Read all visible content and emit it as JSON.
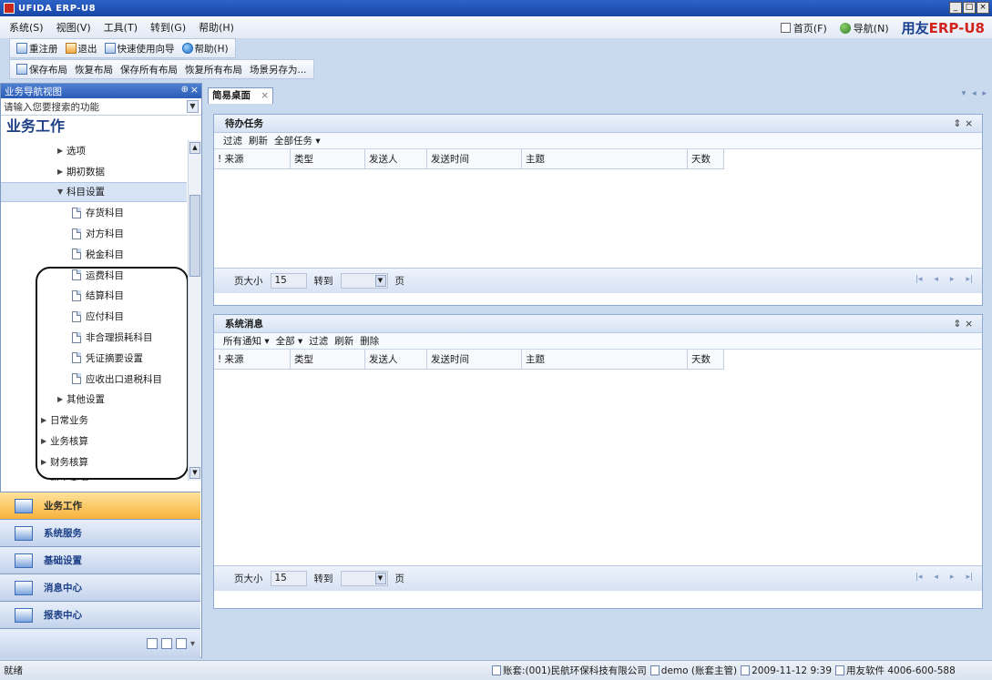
{
  "window": {
    "title": "UFIDA ERP-U8"
  },
  "menu": {
    "items": [
      "系统(S)",
      "视图(V)",
      "工具(T)",
      "转到(G)",
      "帮助(H)"
    ],
    "home": "首页(F)",
    "nav": "导航(N)",
    "brand_a": "用友",
    "brand_b": "ERP-U8"
  },
  "toolbar1": {
    "relogin": "重注册",
    "exit": "退出",
    "wizard": "快速使用向导",
    "help": "帮助(H)"
  },
  "toolbar2": {
    "save_layout": "保存布局",
    "restore_layout": "恢复布局",
    "save_all": "保存所有布局",
    "restore_all": "恢复所有布局",
    "scene_save": "场景另存为..."
  },
  "left": {
    "header": "业务导航视图",
    "search_placeholder": "请输入您要搜索的功能",
    "section": "业务工作",
    "tree": [
      {
        "label": "选项",
        "level": 2,
        "kind": "arrow"
      },
      {
        "label": "期初数据",
        "level": 2,
        "kind": "arrow"
      },
      {
        "label": "科目设置",
        "level": 2,
        "kind": "open"
      },
      {
        "label": "存货科目",
        "level": 3,
        "kind": "doc"
      },
      {
        "label": "对方科目",
        "level": 3,
        "kind": "doc"
      },
      {
        "label": "税金科目",
        "level": 3,
        "kind": "doc"
      },
      {
        "label": "运费科目",
        "level": 3,
        "kind": "doc"
      },
      {
        "label": "结算科目",
        "level": 3,
        "kind": "doc"
      },
      {
        "label": "应付科目",
        "level": 3,
        "kind": "doc"
      },
      {
        "label": "非合理损耗科目",
        "level": 3,
        "kind": "doc"
      },
      {
        "label": "凭证摘要设置",
        "level": 3,
        "kind": "doc"
      },
      {
        "label": "应收出口退税科目",
        "level": 3,
        "kind": "doc"
      },
      {
        "label": "其他设置",
        "level": 2,
        "kind": "arrow"
      },
      {
        "label": "日常业务",
        "level": 1,
        "kind": "arrow"
      },
      {
        "label": "业务核算",
        "level": 1,
        "kind": "arrow"
      },
      {
        "label": "财务核算",
        "level": 1,
        "kind": "arrow"
      },
      {
        "label": "账表查询",
        "level": 1,
        "kind": "arrow"
      }
    ],
    "panes": [
      {
        "label": "业务工作",
        "active": true
      },
      {
        "label": "系统服务",
        "active": false
      },
      {
        "label": "基础设置",
        "active": false
      },
      {
        "label": "消息中心",
        "active": false
      },
      {
        "label": "报表中心",
        "active": false
      }
    ]
  },
  "tab": {
    "label": "简易桌面"
  },
  "todo": {
    "title": "待办任务",
    "tools": [
      "过滤",
      "刷新",
      "全部任务 ▾"
    ],
    "columns": [
      "来源",
      "类型",
      "发送人",
      "发送时间",
      "主题",
      "天数"
    ],
    "page_size_label": "页大小",
    "page_size": "15",
    "goto_label": "转到",
    "page_label": "页"
  },
  "messages": {
    "title": "系统消息",
    "tools": [
      "所有通知 ▾",
      "全部 ▾",
      "过滤",
      "刷新",
      "删除"
    ],
    "columns": [
      "来源",
      "类型",
      "发送人",
      "发送时间",
      "主题",
      "天数"
    ],
    "page_size_label": "页大小",
    "page_size": "15",
    "goto_label": "转到",
    "page_label": "页"
  },
  "status": {
    "ready": "就绪",
    "account": "账套:(001)民航环保科技有限公司",
    "user": "demo (账套主管)",
    "datetime": "2009-11-12 9:39",
    "vendor": "用友软件 4006-600-588"
  }
}
